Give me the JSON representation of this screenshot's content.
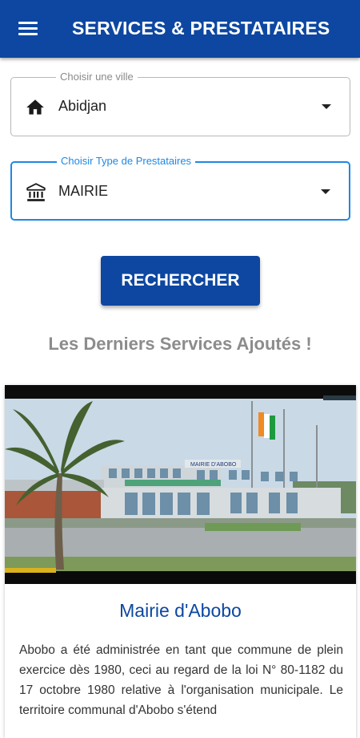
{
  "appbar": {
    "title": "SERVICES & PRESTATAIRES",
    "menu_icon": "hamburger-menu-icon"
  },
  "city_select": {
    "label": "Choisir une ville",
    "value": "Abidjan",
    "icon": "home-icon"
  },
  "type_select": {
    "label": "Choisir Type de Prestataires",
    "value": "MAIRIE",
    "icon": "bank-icon"
  },
  "search_button": {
    "label": "RECHERCHER"
  },
  "section": {
    "title": "Les Derniers Services Ajoutés !"
  },
  "card": {
    "title": "Mairie d'Abobo",
    "image_sign": "MAIRIE D'ABOBO",
    "text": "Abobo a été administrée en tant que commune de plein exercice dès 1980, ceci au regard de la loi N° 80-1182 du 17 octobre 1980 relative à l'organisation municipale. Le territoire communal d'Abobo s'étend"
  },
  "colors": {
    "primary": "#0d47a1",
    "focus": "#1e88e5",
    "muted_text": "#8c8c8c"
  }
}
